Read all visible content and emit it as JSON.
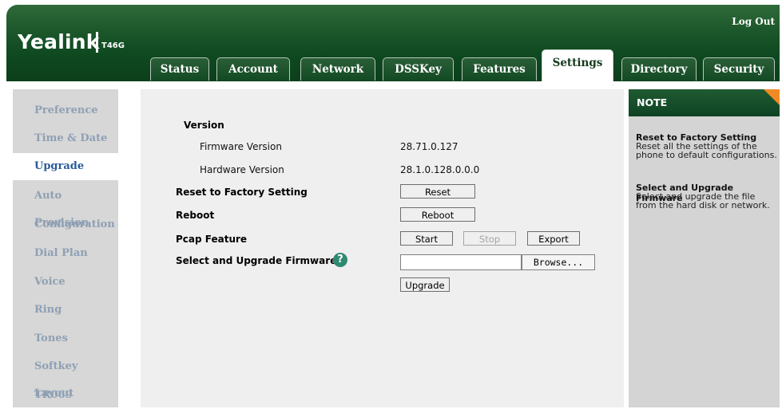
{
  "header": {
    "logo": "Yealink",
    "model": "T46G",
    "logout": "Log Out"
  },
  "tabs": [
    {
      "label": "Status",
      "active": false
    },
    {
      "label": "Account",
      "active": false
    },
    {
      "label": "Network",
      "active": false
    },
    {
      "label": "DSSKey",
      "active": false
    },
    {
      "label": "Features",
      "active": false
    },
    {
      "label": "Settings",
      "active": true
    },
    {
      "label": "Directory",
      "active": false
    },
    {
      "label": "Security",
      "active": false
    }
  ],
  "sidebar": {
    "active": "Upgrade",
    "items": [
      "Preference",
      "Time & Date",
      "Upgrade",
      "Auto Provision",
      "Configuration",
      "Dial Plan",
      "Voice",
      "Ring",
      "Tones",
      "Softkey Layout",
      "TR069"
    ]
  },
  "content": {
    "version_label": "Version",
    "firmware_label": "Firmware Version",
    "firmware_value": "28.71.0.127",
    "hardware_label": "Hardware Version",
    "hardware_value": "28.1.0.128.0.0.0",
    "reset_label": "Reset to Factory Setting",
    "reset_button": "Reset",
    "reboot_label": "Reboot",
    "reboot_button": "Reboot",
    "pcap_label": "Pcap Feature",
    "start_button": "Start",
    "stop_button": "Stop",
    "export_button": "Export",
    "upgrade_fw_label": "Select and Upgrade Firmware",
    "help_glyph": "?",
    "file_value": "",
    "browse_button": "Browse...",
    "upgrade_button": "Upgrade"
  },
  "note": {
    "title": "NOTE",
    "items": [
      {
        "title": "Reset to Factory Setting",
        "text": "Reset all the settings of the phone to default configurations."
      },
      {
        "title": "Select and Upgrade Firmware",
        "text": "Select and upgrade the file from the hard disk or network."
      }
    ]
  },
  "colors": {
    "header_green": "#0f4a21",
    "sidebar_text": "#8fa0b4",
    "sidebar_active_text": "#2a5b9a",
    "note_corner": "#f08a24"
  }
}
